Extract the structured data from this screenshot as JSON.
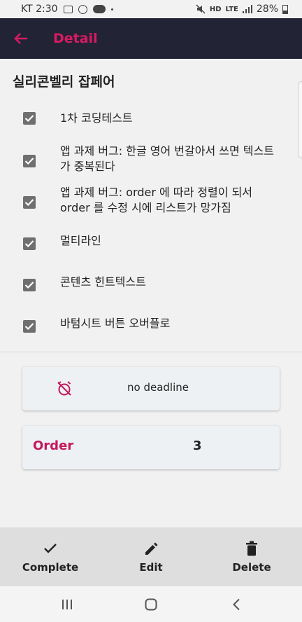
{
  "status_bar": {
    "carrier_time": "KT 2:30",
    "network": "LTE",
    "battery": "28%",
    "icons": [
      "image-icon",
      "alarm-icon",
      "talk-icon",
      "mute-icon",
      "hd-icon",
      "signal-icon",
      "battery-icon"
    ]
  },
  "app_bar": {
    "title": "Detail",
    "back_icon": "arrow-left-icon",
    "background": "#232336",
    "accent": "#d81b60"
  },
  "todo": {
    "title": "실리콘벨리 잡페어",
    "items": [
      {
        "label": "1차 코딩테스트",
        "checked": true
      },
      {
        "label": "앱 과제 버그: 한글 영어 번갈아서 쓰면 텍스트가 중복된다",
        "checked": true
      },
      {
        "label": "앱 과제 버그: order 에 따라 정렬이 되서 order 를 수정 시에 리스트가 망가짐",
        "checked": true
      },
      {
        "label": "멀티라인",
        "checked": true
      },
      {
        "label": "콘텐츠 힌트텍스트",
        "checked": true
      },
      {
        "label": "바텀시트 버튼 오버플로",
        "checked": true
      }
    ]
  },
  "deadline": {
    "icon": "alarm-off-icon",
    "text": "no deadline"
  },
  "order": {
    "label": "Order",
    "value": "3"
  },
  "actions": {
    "complete": {
      "label": "Complete",
      "icon": "check-icon"
    },
    "edit": {
      "label": "Edit",
      "icon": "pencil-icon"
    },
    "delete": {
      "label": "Delete",
      "icon": "trash-icon"
    }
  },
  "nav": {
    "recent": "recent-apps-icon",
    "home": "home-icon",
    "back": "back-icon"
  }
}
